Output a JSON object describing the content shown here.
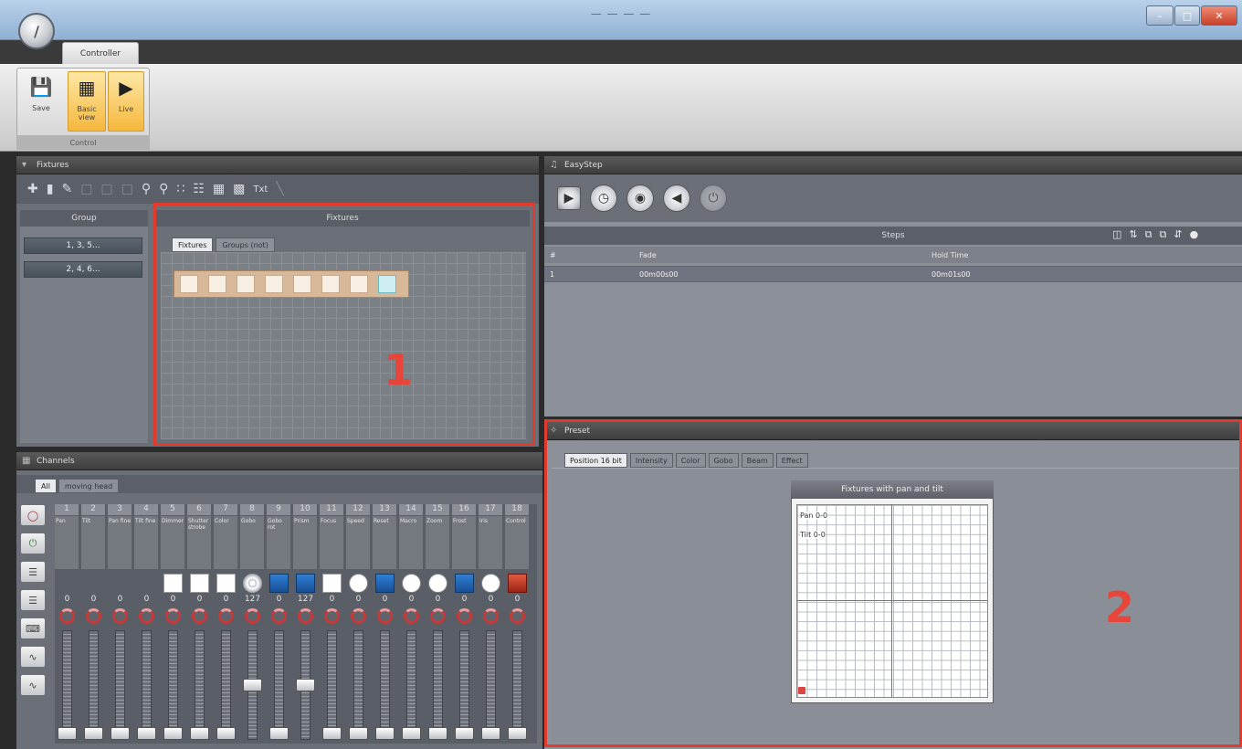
{
  "window": {
    "title": "— — — —"
  },
  "ribbon": {
    "tab": "Controller",
    "group_label": "Control",
    "buttons": {
      "save": "Save",
      "basic_view": "Basic view",
      "live": "Live"
    }
  },
  "fixtures_panel": {
    "title": "Fixtures",
    "group_header": "Group",
    "groups": [
      "1, 3, 5...",
      "2, 4, 6..."
    ],
    "fixtures_header": "Fixtures",
    "tabs": [
      "Fixtures",
      "Groups (not)"
    ],
    "toolbar_text": "Txt",
    "fixture_count": 8
  },
  "easystep": {
    "title": "EasyStep",
    "steps_header": "Steps",
    "columns": [
      "#",
      "Fade",
      "Hold Time"
    ],
    "rows": [
      {
        "num": "1",
        "fade": "00m00s00",
        "hold": "00m01s00"
      }
    ]
  },
  "channels": {
    "title": "Channels",
    "tabs": [
      "All",
      "moving head"
    ],
    "items": [
      {
        "num": "1",
        "name": "Pan",
        "value": "0",
        "icon": "none"
      },
      {
        "num": "2",
        "name": "Tilt",
        "value": "0",
        "icon": "none"
      },
      {
        "num": "3",
        "name": "Pan fine",
        "value": "0",
        "icon": "none"
      },
      {
        "num": "4",
        "name": "Tilt fine",
        "value": "0",
        "icon": "none"
      },
      {
        "num": "5",
        "name": "Dimmer",
        "value": "0",
        "icon": "white"
      },
      {
        "num": "6",
        "name": "Shutter strobe",
        "value": "0",
        "icon": "white"
      },
      {
        "num": "7",
        "name": "Color",
        "value": "0",
        "icon": "white"
      },
      {
        "num": "8",
        "name": "Gobo",
        "value": "127",
        "icon": "gobo"
      },
      {
        "num": "9",
        "name": "Gobo rot",
        "value": "0",
        "icon": "blue"
      },
      {
        "num": "10",
        "name": "Prism",
        "value": "127",
        "icon": "blue"
      },
      {
        "num": "11",
        "name": "Focus",
        "value": "0",
        "icon": "white"
      },
      {
        "num": "12",
        "name": "Speed",
        "value": "0",
        "icon": "circle"
      },
      {
        "num": "13",
        "name": "Reset",
        "value": "0",
        "icon": "blue"
      },
      {
        "num": "14",
        "name": "Macro",
        "value": "0",
        "icon": "circle"
      },
      {
        "num": "15",
        "name": "Zoom",
        "value": "0",
        "icon": "circle"
      },
      {
        "num": "16",
        "name": "Frost",
        "value": "0",
        "icon": "blue"
      },
      {
        "num": "17",
        "name": "Iris",
        "value": "0",
        "icon": "circle"
      },
      {
        "num": "18",
        "name": "Control",
        "value": "0",
        "icon": "red"
      }
    ],
    "fader_levels": [
      0,
      0,
      0,
      0,
      0,
      0,
      0,
      0.5,
      0,
      0.5,
      0,
      0,
      0,
      0,
      0,
      0,
      0,
      0
    ]
  },
  "preset": {
    "title": "Preset",
    "tabs": [
      "Position 16 bit",
      "Intensity",
      "Color",
      "Gobo",
      "Beam",
      "Effect"
    ],
    "box_title": "Fixtures with pan and tilt",
    "pan_label": "Pan 0-0",
    "tilt_label": "Tilt 0-0"
  },
  "annotations": {
    "label1": "1",
    "label2": "2"
  }
}
